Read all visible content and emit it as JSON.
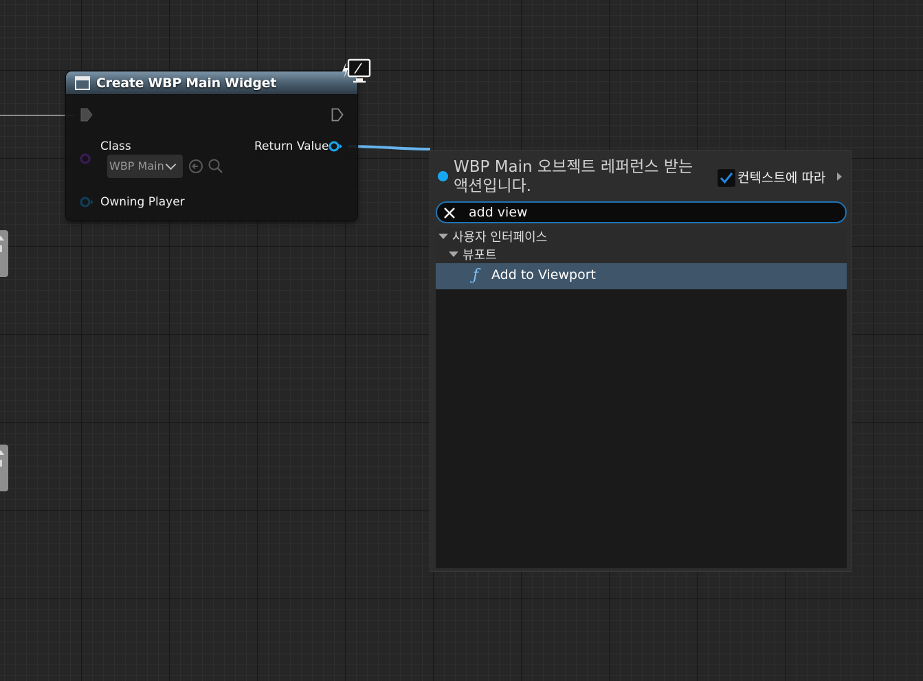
{
  "node": {
    "title": "Create WBP Main Widget",
    "pins": {
      "class_label": "Class",
      "class_value": "WBP Main",
      "return_label": "Return Value",
      "owning_player_label": "Owning Player"
    },
    "icons": [
      "widget-icon",
      "exec-in-icon",
      "exec-out-icon",
      "browse-back-icon",
      "search-icon",
      "latent-screen-icon"
    ]
  },
  "context_menu": {
    "title": "WBP Main 오브젝트 레퍼런스 받는 액션입니다.",
    "context_sensitive_label": "컨텍스트에 따라",
    "context_sensitive_checked": true,
    "search": {
      "value": "add view",
      "placeholder": ""
    },
    "tree": {
      "category": "사용자 인터페이스",
      "subcategory": "뷰포트",
      "items": [
        {
          "label": "Add to Viewport",
          "icon": "function-icon",
          "selected": true
        }
      ]
    }
  },
  "colors": {
    "accent_blue": "#16a9f1",
    "selection": "#3f5569",
    "search_border": "#1f74b6",
    "header_blue": "#4e6373",
    "grid_bg": "#262626"
  }
}
